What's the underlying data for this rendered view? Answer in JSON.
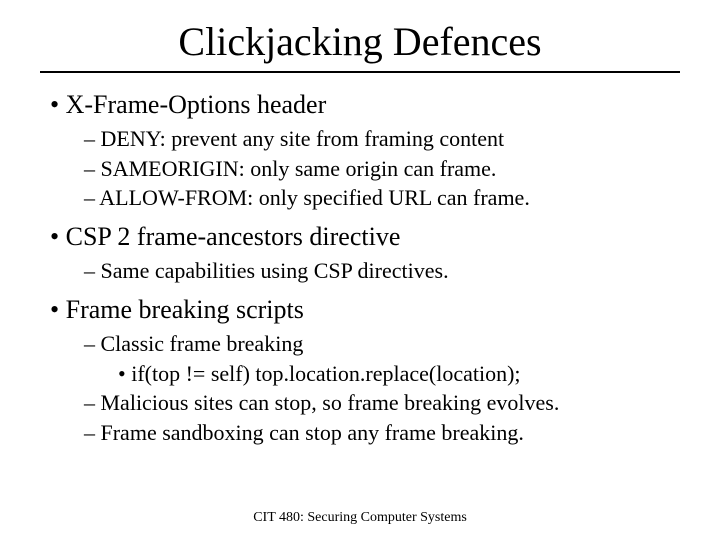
{
  "title": "Clickjacking Defences",
  "bullets": {
    "b0": {
      "text": "X-Frame-Options header",
      "sub": [
        "DENY: prevent any site from framing content",
        "SAMEORIGIN: only same origin can frame.",
        "ALLOW-FROM: only specified URL can frame."
      ]
    },
    "b1": {
      "text": "CSP 2 frame-ancestors directive",
      "sub": [
        "Same capabilities using CSP directives."
      ]
    },
    "b2": {
      "text": "Frame breaking scripts",
      "sub0": "Classic frame breaking",
      "sub0a": "if(top != self) top.location.replace(location);",
      "sub1": "Malicious sites can stop, so frame breaking evolves.",
      "sub2": "Frame sandboxing can stop any frame breaking."
    }
  },
  "footer": "CIT 480: Securing Computer Systems"
}
